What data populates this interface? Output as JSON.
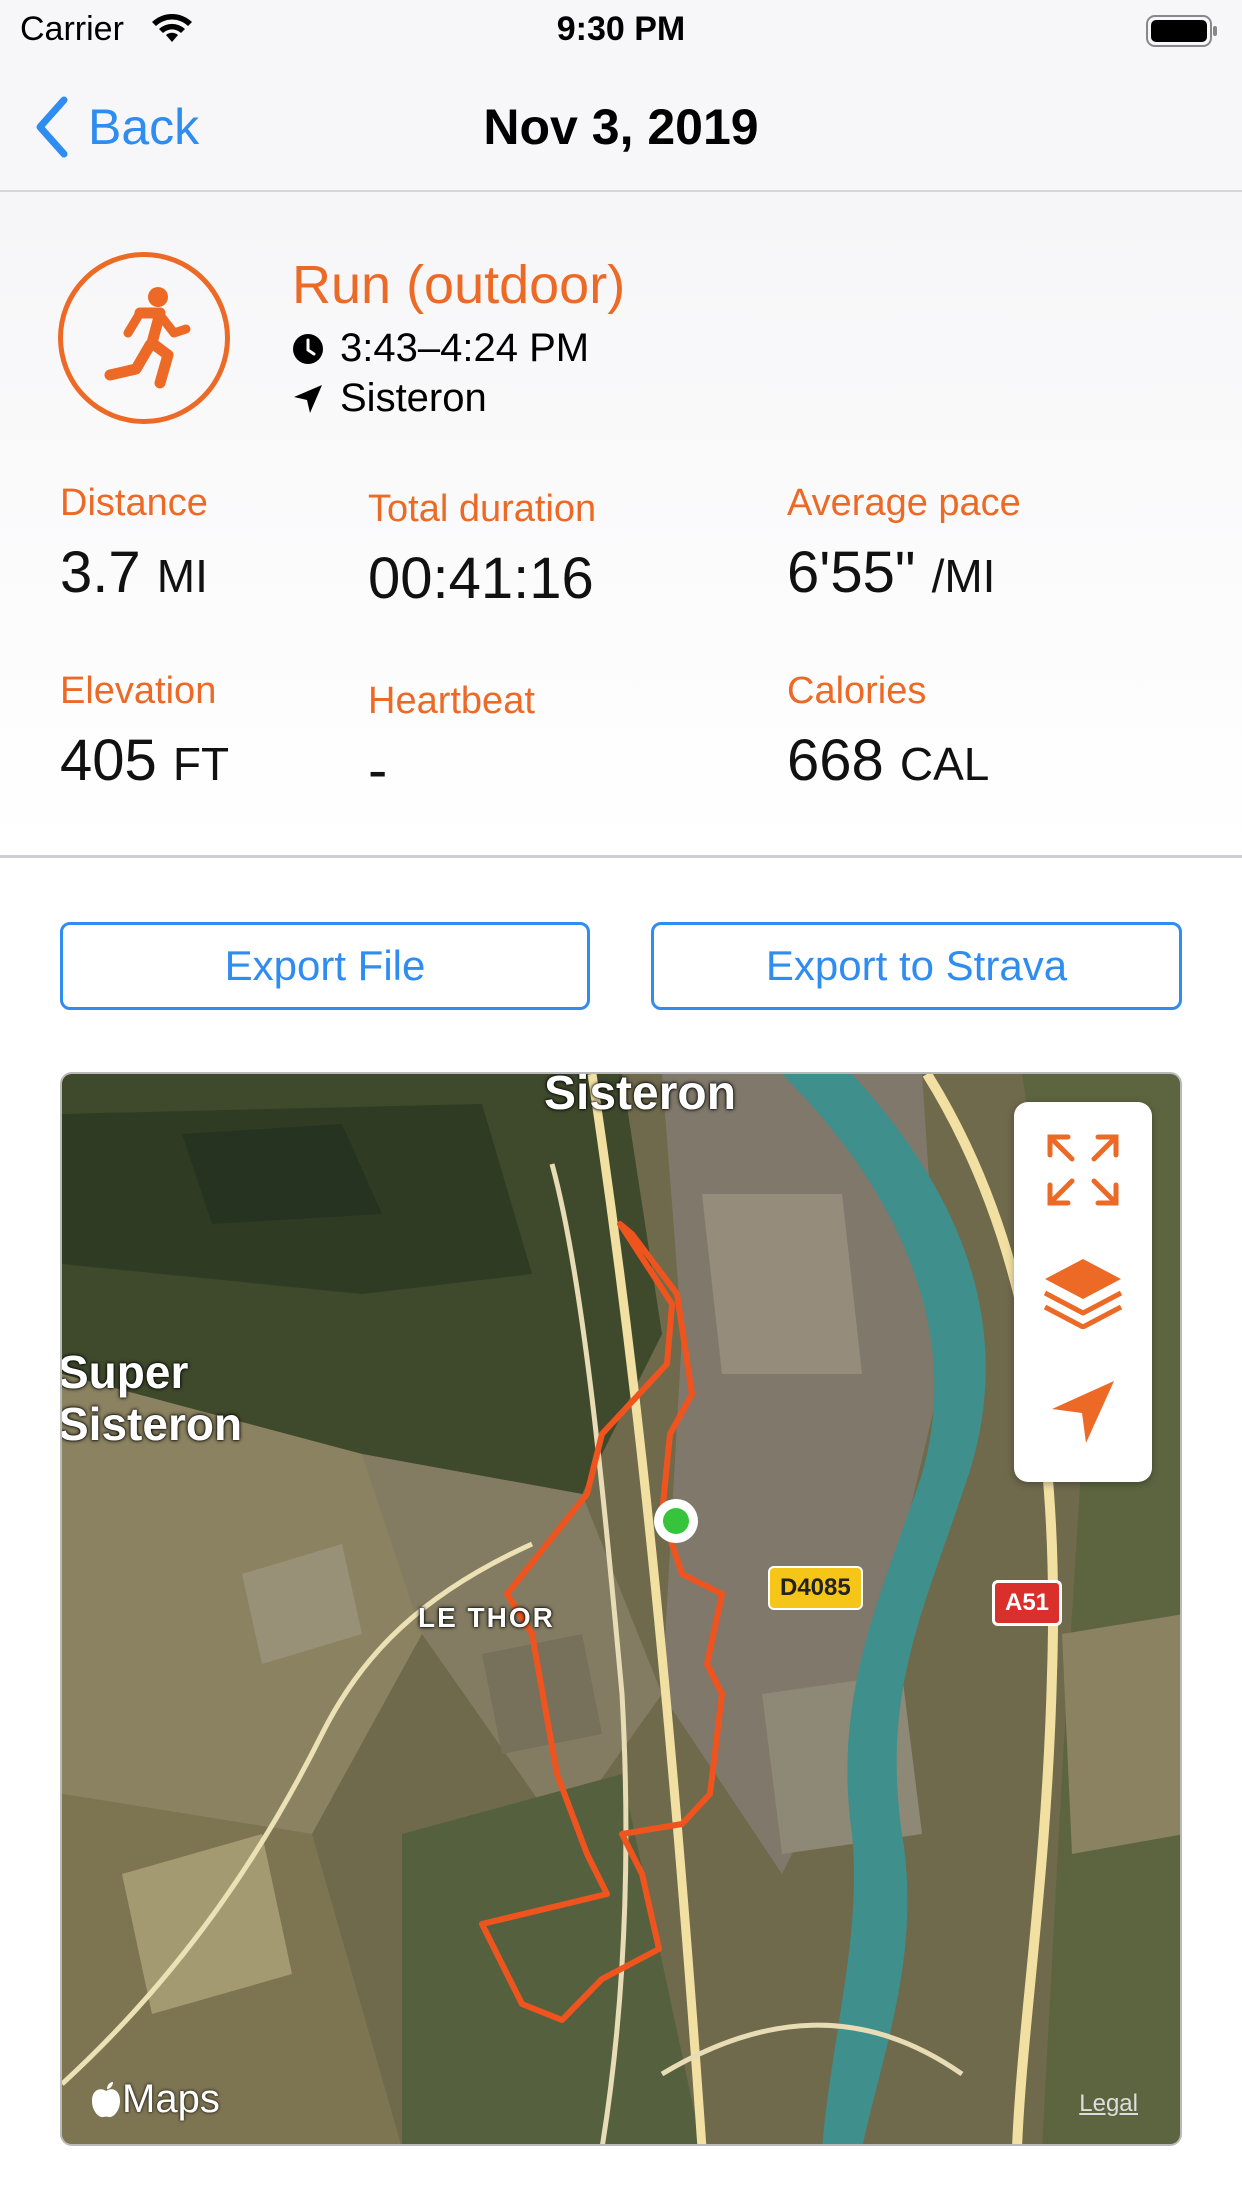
{
  "status_bar": {
    "carrier": "Carrier",
    "time": "9:30 PM"
  },
  "nav": {
    "back_label": "Back",
    "title": "Nov 3, 2019"
  },
  "activity": {
    "name": "Run (outdoor)",
    "time_range": "3:43–4:24 PM",
    "location": "Sisteron",
    "icon": "running-figure-icon"
  },
  "stats": {
    "distance": {
      "label": "Distance",
      "value": "3.7",
      "unit": "MI"
    },
    "total_duration": {
      "label": "Total duration",
      "value": "00:41:16",
      "unit": ""
    },
    "average_pace": {
      "label": "Average pace",
      "value": "6'55\"",
      "unit": "/MI"
    },
    "elevation": {
      "label": "Elevation",
      "value": "405",
      "unit": "FT"
    },
    "heartbeat": {
      "label": "Heartbeat",
      "value": "-",
      "unit": ""
    },
    "calories": {
      "label": "Calories",
      "value": "668",
      "unit": "CAL"
    }
  },
  "buttons": {
    "export_file": "Export File",
    "export_strava": "Export to Strava"
  },
  "map": {
    "labels": {
      "sisteron": "Sisteron",
      "super_sisteron": "Super Sisteron",
      "le_thor": "LE THOR",
      "road_d4085": "D4085",
      "road_a51": "A51"
    },
    "logo": "Maps",
    "legal": "Legal",
    "controls": [
      "expand-icon",
      "layers-icon",
      "location-arrow-icon"
    ]
  },
  "colors": {
    "accent": "#ec6a26",
    "link": "#2f8cf0",
    "route": "#f0541e"
  }
}
